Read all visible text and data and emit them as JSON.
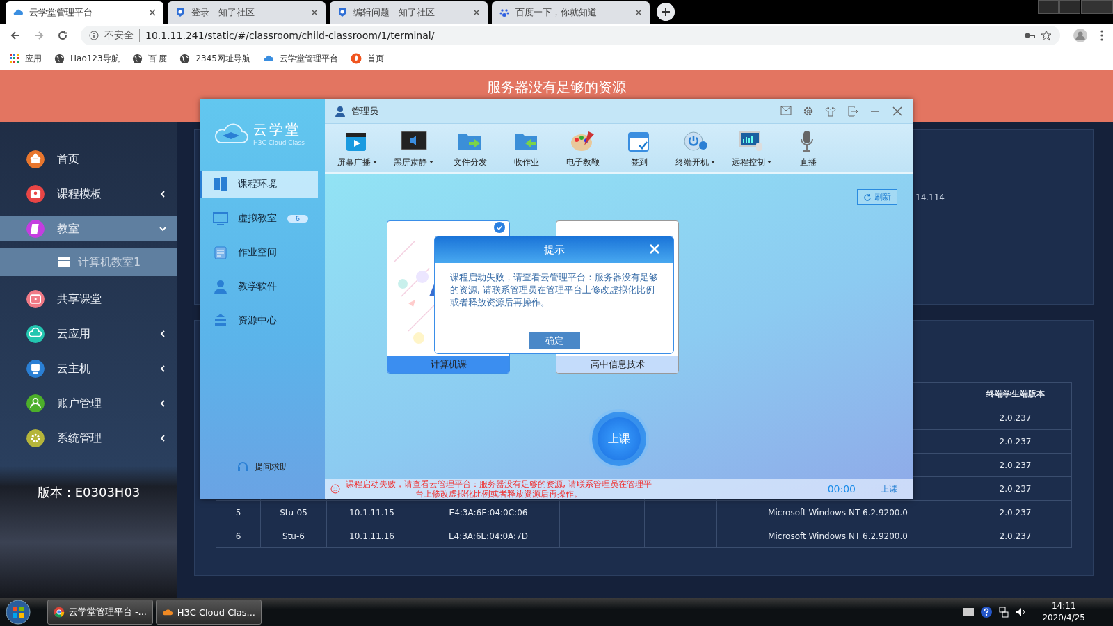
{
  "browser": {
    "tabs": [
      {
        "title": "云学堂管理平台",
        "selected": true
      },
      {
        "title": "登录 - 知了社区",
        "selected": false
      },
      {
        "title": "编辑问题 - 知了社区",
        "selected": false
      },
      {
        "title": "百度一下，你就知道",
        "selected": false
      }
    ],
    "security": "不安全",
    "url": "10.1.11.241/static/#/classroom/child-classroom/1/terminal/",
    "bookmarks": [
      {
        "label": "应用"
      },
      {
        "label": "Hao123导航"
      },
      {
        "label": "百 度"
      },
      {
        "label": "2345网址导航"
      },
      {
        "label": "云学堂管理平台"
      },
      {
        "label": "首页"
      }
    ]
  },
  "page": {
    "banner": "服务器没有足够的资源",
    "sidebar": {
      "items": [
        {
          "label": "首页",
          "kind": "link",
          "color": "#e8762d",
          "selected": false
        },
        {
          "label": "课程模板",
          "kind": "menu",
          "color": "#e84545",
          "selected": false,
          "expanded": false
        },
        {
          "label": "教室",
          "kind": "menu",
          "color": "#c43ee0",
          "selected": true,
          "expanded": true,
          "children": [
            {
              "label": "计算机教室1",
              "selected": true
            }
          ]
        },
        {
          "label": "共享课堂",
          "kind": "link",
          "color": "#f07a86",
          "selected": false
        },
        {
          "label": "云应用",
          "kind": "menu",
          "color": "#23c6b0",
          "selected": false,
          "expanded": false
        },
        {
          "label": "云主机",
          "kind": "menu",
          "color": "#2a7fd4",
          "selected": false,
          "expanded": false
        },
        {
          "label": "账户管理",
          "kind": "menu",
          "color": "#4caf2a",
          "selected": false,
          "expanded": false
        },
        {
          "label": "系统管理",
          "kind": "menu",
          "color": "#b5b53a",
          "selected": false,
          "expanded": false
        }
      ]
    },
    "version": "版本：E0303H03",
    "ip_fragment": "14.114",
    "table": {
      "heading": "终端学生端版本",
      "rows": [
        {
          "version": "2.0.237"
        },
        {
          "version": "2.0.237"
        },
        {
          "version": "2.0.237"
        },
        {
          "version": "2.0.237"
        },
        {
          "no": "5",
          "name": "Stu-05",
          "ip": "10.1.11.15",
          "mac": "E4:3A:6E:04:0C:06",
          "os": "Microsoft Windows NT 6.2.9200.0",
          "version": "2.0.237"
        },
        {
          "no": "6",
          "name": "Stu-6",
          "ip": "10.1.11.16",
          "mac": "E4:3A:6E:04:0A:7D",
          "os": "Microsoft Windows NT 6.2.9200.0",
          "version": "2.0.237"
        }
      ]
    }
  },
  "app": {
    "logo_title": "云学堂",
    "logo_subtitle": "H3C Cloud Class",
    "user": "管理员",
    "nav": [
      {
        "label": "课程环境",
        "selected": true
      },
      {
        "label": "虚拟教室",
        "selected": false,
        "badge": "6"
      },
      {
        "label": "作业空间",
        "selected": false
      },
      {
        "label": "教学软件",
        "selected": false
      },
      {
        "label": "资源中心",
        "selected": false
      }
    ],
    "help": "提问求助",
    "toolbar": [
      {
        "label": "屏幕广播",
        "dropdown": true
      },
      {
        "label": "黑屏肃静",
        "dropdown": true
      },
      {
        "label": "文件分发",
        "dropdown": false
      },
      {
        "label": "收作业",
        "dropdown": false
      },
      {
        "label": "电子教鞭",
        "dropdown": false
      },
      {
        "label": "签到",
        "dropdown": false
      },
      {
        "label": "终端开机",
        "dropdown": true
      },
      {
        "label": "远程控制",
        "dropdown": true
      },
      {
        "label": "直播",
        "dropdown": false
      }
    ],
    "refresh": "刷新",
    "courses": [
      {
        "name": "计算机课",
        "selected": true
      },
      {
        "name": "高中信息技术",
        "selected": false
      }
    ],
    "dialog": {
      "title": "提示",
      "message": "课程启动失败，请查看云管理平台：服务器没有足够的资源, 请联系管理员在管理平台上修改虚拟化比例或者释放资源后再操作。",
      "ok": "确定"
    },
    "start_button": "上课",
    "status": {
      "error": "课程启动失败，请查看云管理平台：服务器没有足够的资源, 请联系管理员在管理平台上修改虚拟化比例或者释放资源后再操作。",
      "timer": "00:00",
      "state": "上课"
    }
  },
  "taskbar": {
    "tasks": [
      {
        "label": "云学堂管理平台 -..."
      },
      {
        "label": "H3C Cloud Clas..."
      }
    ],
    "time": "14:11",
    "date": "2020/4/25"
  }
}
